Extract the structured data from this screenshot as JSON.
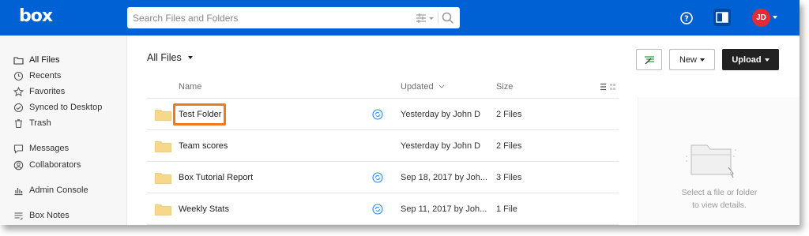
{
  "app": {
    "logo": "box",
    "search_placeholder": "Search Files and Folders",
    "user_initials": "JD"
  },
  "sidebar": {
    "items": [
      {
        "label": "All Files",
        "icon": "folder-icon",
        "active": true
      },
      {
        "label": "Recents",
        "icon": "clock-icon"
      },
      {
        "label": "Favorites",
        "icon": "star-icon"
      },
      {
        "label": "Synced to Desktop",
        "icon": "check-circle-icon"
      },
      {
        "label": "Trash",
        "icon": "trash-icon"
      },
      {
        "label": "Messages",
        "icon": "message-icon"
      },
      {
        "label": "Collaborators",
        "icon": "user-circle-icon"
      },
      {
        "label": "Admin Console",
        "icon": "bar-chart-icon"
      },
      {
        "label": "Box Notes",
        "icon": "notes-icon"
      }
    ]
  },
  "main": {
    "breadcrumb": "All Files",
    "buttons": {
      "new_label": "New",
      "upload_label": "Upload"
    },
    "columns": {
      "name": "Name",
      "updated": "Updated",
      "size": "Size"
    },
    "rows": [
      {
        "name": "Test Folder",
        "updated": "Yesterday by John D",
        "size": "2 Files",
        "synced": true,
        "highlighted": true
      },
      {
        "name": "Team scores",
        "updated": "Yesterday by John D",
        "size": "2 Files",
        "synced": false
      },
      {
        "name": "Box Tutorial Report",
        "updated": "Sep 18, 2017 by Joh...",
        "size": "3 Files",
        "synced": true
      },
      {
        "name": "Weekly Stats",
        "updated": "Sep 11, 2017 by Joh...",
        "size": "1 File",
        "synced": true
      }
    ],
    "details_empty": {
      "line1": "Select a file or folder",
      "line2": "to view details."
    }
  },
  "colors": {
    "brand": "#0061d5",
    "folder": "#f5d88a",
    "highlight": "#f07a1a",
    "avatar": "#e02b38"
  }
}
